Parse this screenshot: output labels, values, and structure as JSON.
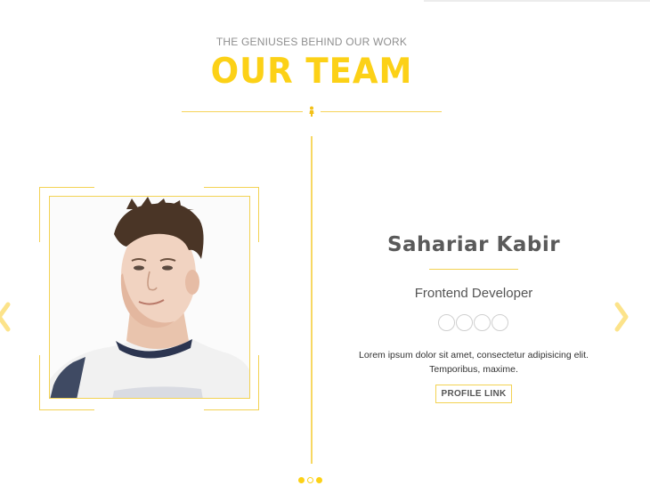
{
  "header": {
    "subtitle": "THE GENIUSES BEHIND OUR WORK",
    "title": "OUR TEAM"
  },
  "member": {
    "name": "Sahariar Kabir",
    "role": "Frontend Developer",
    "bio": "Lorem ipsum dolor sit amet, consectetur adipisicing elit. Temporibus, maxime.",
    "profile_link_label": "PROFILE LINK",
    "photo_icon": "portrait-photo"
  },
  "carousel": {
    "prev_icon": "chevron-left-icon",
    "next_icon": "chevron-right-icon",
    "slide_count": 3,
    "active_slide": 2
  },
  "colors": {
    "accent": "#fcd117",
    "heading_gray": "#5a5a5a",
    "subtitle_gray": "#8f8f8f"
  }
}
